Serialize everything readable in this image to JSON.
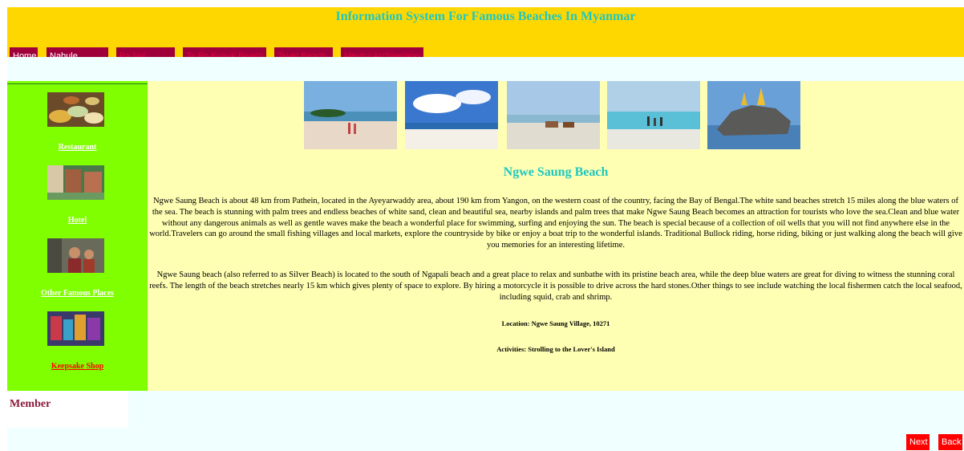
{
  "site": {
    "title": "Information System For Famous Beaches In Myanmar"
  },
  "nav": [
    {
      "label": "Home"
    },
    {
      "label": "Nabule Beach"
    },
    {
      "label": "Pa Nyi Beach"
    },
    {
      "label": "Ta Po Kyauk Beach"
    },
    {
      "label": "Teyet Beach"
    },
    {
      "label": "Mergui Archipelago"
    }
  ],
  "sidebar": {
    "links": [
      {
        "label": "Restaurant"
      },
      {
        "label": "Hotel"
      },
      {
        "label": "Other Famous Places"
      },
      {
        "label": "Keepsake Shop"
      }
    ]
  },
  "main": {
    "title": "Ngwe Saung Beach",
    "paragraph1": "Ngwe Saung Beach is about 48 km from Pathein, located in the Ayeyarwaddy area, about 190 km from Yangon, on the western coast of the country, facing the Bay of Bengal.The white sand beaches stretch 15 miles along the blue waters of the sea. The beach is stunning with palm trees and endless beaches of white sand, clean and beautiful sea, nearby islands and palm trees that make Ngwe Saung Beach becomes an attraction for tourists who love the sea.Clean and blue water without any dangerous animals as well as gentle waves make the beach a wonderful place for swimming, surfing and enjoying the sun. The beach is special because of a collection of oil wells that you will not find anywhere else in the world.Travelers can go around the small fishing villages and local markets, explore the countryside by bike or enjoy a boat trip to the wonderful islands. Traditional Bullock riding, horse riding, biking or just walking along the beach will give you memories for an interesting lifetime.",
    "paragraph2": "Ngwe Saung beach (also referred to as Silver Beach) is located to the south of Ngapali beach and a great place to relax and sunbathe with its pristine beach area, while the deep blue waters are great for diving to witness the stunning coral reefs. The length of the beach stretches nearly 15 km which gives plenty of space to explore. By hiring a motorcycle it is possible to drive across the hard stones.Other things to see include watching the local fishermen catch the local seafood, including squid, crab and shrimp.",
    "location": "Location: Ngwe Saung Village, 10271",
    "activities": "Activities: Strolling to the Lover's Island"
  },
  "member": {
    "title": "Member"
  },
  "footer": {
    "next": "Next",
    "back": "Back"
  },
  "colors": {
    "header": "#ffd700",
    "accent": "#1ec8c0",
    "sidebar": "#80ff00",
    "content": "#ffffb3",
    "nav": "#a0003a",
    "button": "#ff0000"
  }
}
